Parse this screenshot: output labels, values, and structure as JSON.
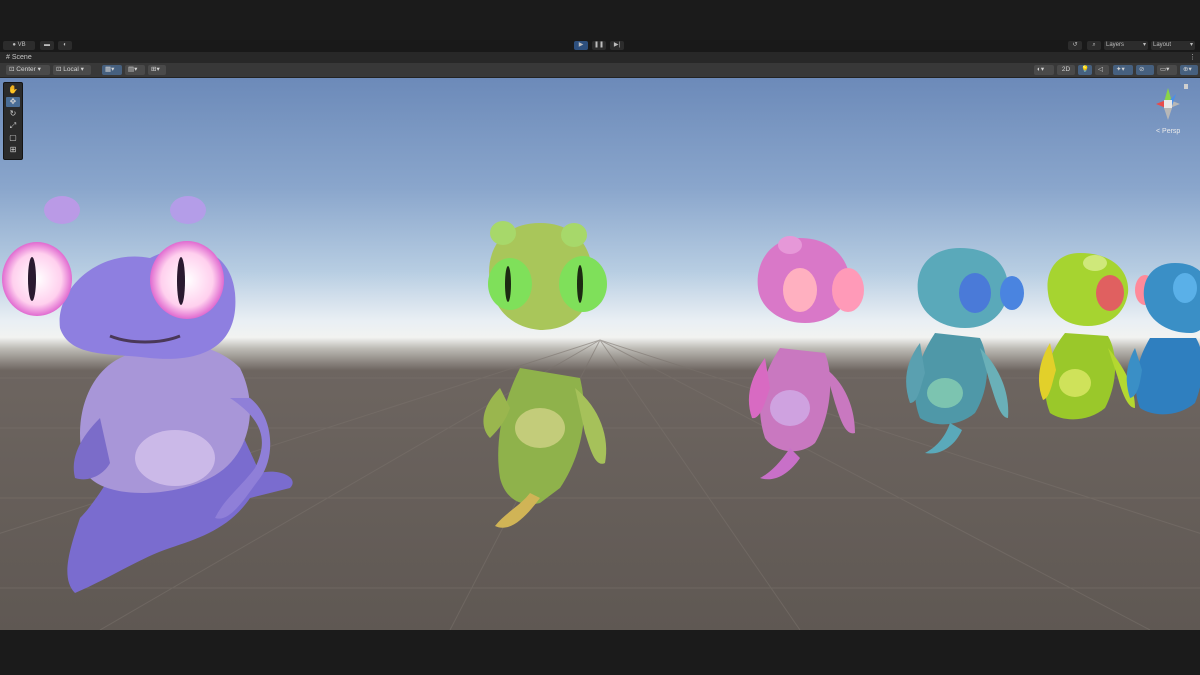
{
  "toolbar": {
    "account_label": "VB",
    "layers_label": "Layers",
    "layout_label": "Layout"
  },
  "scene_tab": {
    "label": "Scene"
  },
  "scene_toolbar": {
    "pivot_label": "Center",
    "space_label": "Local",
    "mode_2d_label": "2D"
  },
  "viewport": {
    "projection_label": "< Persp",
    "characters": [
      {
        "name": "purple-alien",
        "color": "#8e7fe0"
      },
      {
        "name": "green-alien",
        "color": "#a9c65a"
      },
      {
        "name": "pink-alien",
        "color": "#d978c8"
      },
      {
        "name": "teal-alien",
        "color": "#5aa9ba"
      },
      {
        "name": "lime-alien",
        "color": "#a6d430"
      },
      {
        "name": "blue-alien",
        "color": "#3a8fc6"
      }
    ]
  },
  "gizmo_axes": {
    "x": "#e84b4b",
    "y": "#8bd448",
    "z": "#4a8fe8"
  }
}
